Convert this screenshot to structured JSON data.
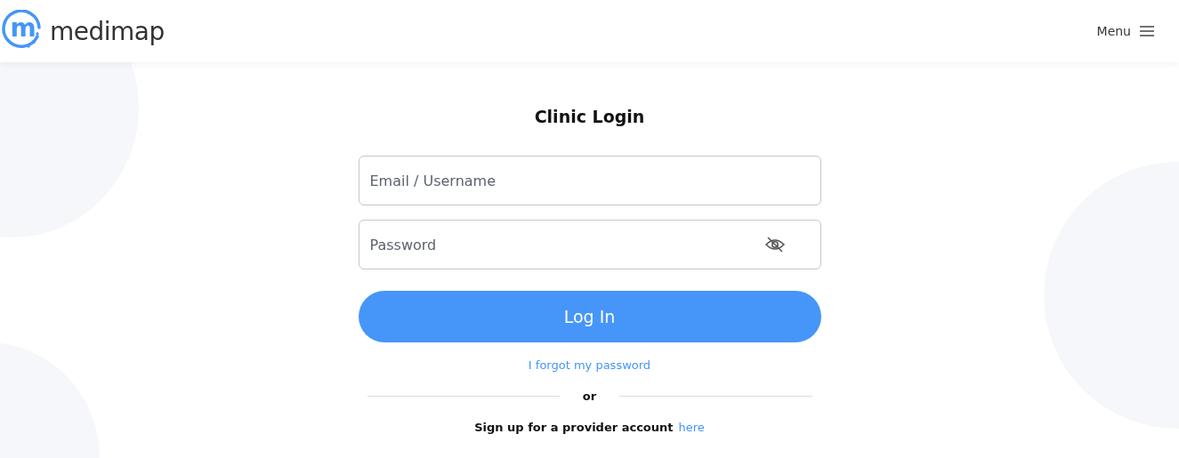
{
  "header": {
    "logo": {
      "mark": "m",
      "name": "medimap"
    },
    "menu": {
      "label": "Menu"
    }
  },
  "login": {
    "title": "Clinic Login",
    "fields": [
      {
        "kind": "text",
        "placeholder": "Email / Username"
      },
      {
        "kind": "password",
        "placeholder": "Password"
      }
    ],
    "button": "Log In",
    "forgot_link": "I forgot my password",
    "divider": "or",
    "signup": {
      "text": "Sign up for a provider account",
      "link": "here"
    }
  }
}
